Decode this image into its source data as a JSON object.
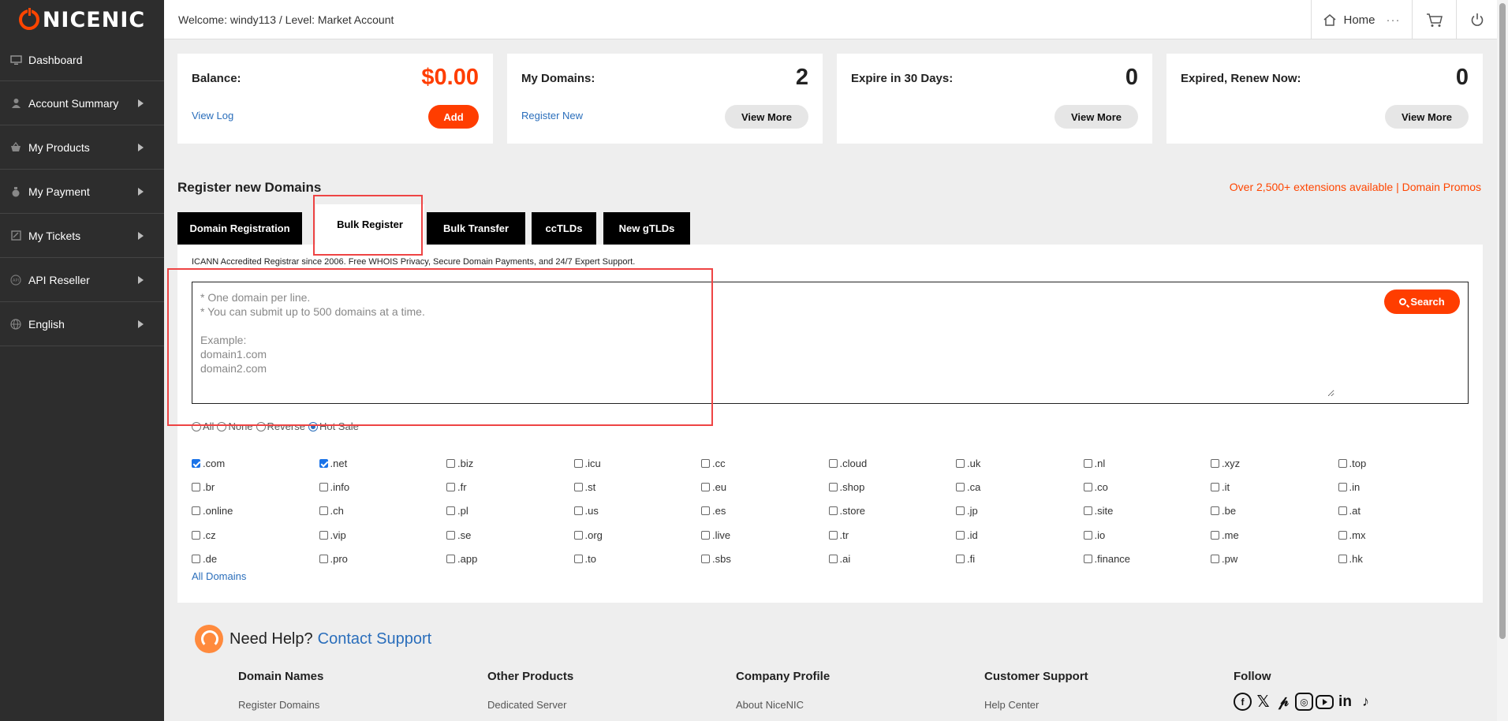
{
  "brand": {
    "logo_text_1": "NICE",
    "logo_text_2": "NIC"
  },
  "sidebar": {
    "items": [
      {
        "label": "Dashboard",
        "icon": "monitor-icon"
      },
      {
        "label": "Account Summary",
        "icon": "user-icon"
      },
      {
        "label": "My Products",
        "icon": "basket-icon"
      },
      {
        "label": "My Payment",
        "icon": "moneybag-icon"
      },
      {
        "label": "My Tickets",
        "icon": "ticket-icon"
      },
      {
        "label": "API Reseller",
        "icon": "api-icon"
      },
      {
        "label": "English",
        "icon": "globe-icon"
      }
    ]
  },
  "topbar": {
    "welcome": "Welcome: windy113  /  Level: Market Account",
    "home_label": "Home",
    "more_dots": "···"
  },
  "cards": {
    "balance": {
      "label": "Balance:",
      "value": "$0.00",
      "link": "View Log",
      "button": "Add"
    },
    "domains": {
      "label": "My Domains:",
      "value": "2",
      "link": "Register New",
      "button": "View More"
    },
    "expire": {
      "label": "Expire in 30 Days:",
      "value": "0",
      "button": "View More"
    },
    "expired": {
      "label": "Expired, Renew Now:",
      "value": "0",
      "button": "View More"
    }
  },
  "register": {
    "title": "Register new Domains",
    "promo": "Over 2,500+ extensions available | Domain Promos",
    "tabs": [
      "Domain Registration",
      "Bulk Register",
      "Bulk Transfer",
      "ccTLDs",
      "New gTLDs"
    ],
    "active_tab": "Bulk Register",
    "icann": "ICANN Accredited Registrar since 2006. Free WHOIS Privacy, Secure Domain Payments, and 24/7 Expert Support.",
    "textarea_placeholder": "* One domain per line.\n* You can submit up to 500 domains at a time.\n\nExample:\ndomain1.com\ndomain2.com",
    "search_button": "Search",
    "radio_options": [
      {
        "label": "All",
        "checked": false
      },
      {
        "label": "None",
        "checked": false
      },
      {
        "label": "Reverse",
        "checked": false
      },
      {
        "label": "Hot Sale",
        "checked": true
      }
    ],
    "tlds": [
      {
        "name": ".com",
        "checked": true
      },
      {
        "name": ".net",
        "checked": true
      },
      {
        "name": ".biz",
        "checked": false
      },
      {
        "name": ".icu",
        "checked": false
      },
      {
        "name": ".cc",
        "checked": false
      },
      {
        "name": ".cloud",
        "checked": false
      },
      {
        "name": ".uk",
        "checked": false
      },
      {
        "name": ".nl",
        "checked": false
      },
      {
        "name": ".xyz",
        "checked": false
      },
      {
        "name": ".top",
        "checked": false
      },
      {
        "name": ".br",
        "checked": false
      },
      {
        "name": ".info",
        "checked": false
      },
      {
        "name": ".fr",
        "checked": false
      },
      {
        "name": ".st",
        "checked": false
      },
      {
        "name": ".eu",
        "checked": false
      },
      {
        "name": ".shop",
        "checked": false
      },
      {
        "name": ".ca",
        "checked": false
      },
      {
        "name": ".co",
        "checked": false
      },
      {
        "name": ".it",
        "checked": false
      },
      {
        "name": ".in",
        "checked": false
      },
      {
        "name": ".online",
        "checked": false
      },
      {
        "name": ".ch",
        "checked": false
      },
      {
        "name": ".pl",
        "checked": false
      },
      {
        "name": ".us",
        "checked": false
      },
      {
        "name": ".es",
        "checked": false
      },
      {
        "name": ".store",
        "checked": false
      },
      {
        "name": ".jp",
        "checked": false
      },
      {
        "name": ".site",
        "checked": false
      },
      {
        "name": ".be",
        "checked": false
      },
      {
        "name": ".at",
        "checked": false
      },
      {
        "name": ".cz",
        "checked": false
      },
      {
        "name": ".vip",
        "checked": false
      },
      {
        "name": ".se",
        "checked": false
      },
      {
        "name": ".org",
        "checked": false
      },
      {
        "name": ".live",
        "checked": false
      },
      {
        "name": ".tr",
        "checked": false
      },
      {
        "name": ".id",
        "checked": false
      },
      {
        "name": ".io",
        "checked": false
      },
      {
        "name": ".me",
        "checked": false
      },
      {
        "name": ".mx",
        "checked": false
      },
      {
        "name": ".de",
        "checked": false
      },
      {
        "name": ".pro",
        "checked": false
      },
      {
        "name": ".app",
        "checked": false
      },
      {
        "name": ".to",
        "checked": false
      },
      {
        "name": ".sbs",
        "checked": false
      },
      {
        "name": ".ai",
        "checked": false
      },
      {
        "name": ".fi",
        "checked": false
      },
      {
        "name": ".finance",
        "checked": false
      },
      {
        "name": ".pw",
        "checked": false
      },
      {
        "name": ".hk",
        "checked": false
      }
    ],
    "all_domains_link": "All Domains"
  },
  "help": {
    "text": "Need Help?",
    "link": "Contact Support"
  },
  "footer": {
    "columns": [
      {
        "title": "Domain Names",
        "link": "Register Domains"
      },
      {
        "title": "Other Products",
        "link": "Dedicated Server"
      },
      {
        "title": "Company Profile",
        "link": "About NiceNIC"
      },
      {
        "title": "Customer Support",
        "link": "Help Center"
      }
    ],
    "follow_title": "Follow",
    "social_icons": [
      "facebook-icon",
      "x-icon",
      "pinterest-icon",
      "instagram-icon",
      "youtube-icon",
      "linkedin-icon",
      "tiktok-icon"
    ]
  },
  "colors": {
    "accent": "#ff3d00",
    "link": "#2a6ebb",
    "sidebar_bg": "#2d2d2d",
    "highlight": "#ee4444"
  }
}
